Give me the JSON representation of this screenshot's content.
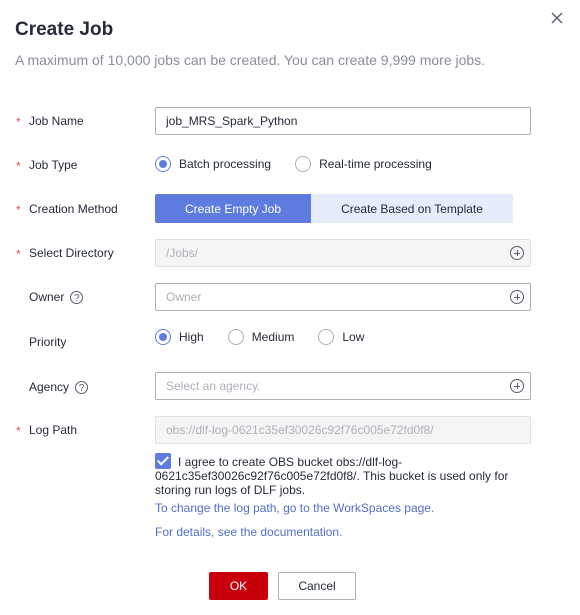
{
  "dialog": {
    "title": "Create Job",
    "subtitle": "A maximum of 10,000 jobs can be created. You can create 9,999 more jobs."
  },
  "form": {
    "job_name": {
      "label": "Job Name",
      "value": "job_MRS_Spark_Python"
    },
    "job_type": {
      "label": "Job Type",
      "options": [
        "Batch processing",
        "Real-time processing"
      ],
      "selected": "Batch processing"
    },
    "creation_method": {
      "label": "Creation Method",
      "options": [
        "Create Empty Job",
        "Create Based on Template"
      ],
      "selected": "Create Empty Job"
    },
    "select_directory": {
      "label": "Select Directory",
      "value": "/Jobs/"
    },
    "owner": {
      "label": "Owner",
      "placeholder": "Owner"
    },
    "priority": {
      "label": "Priority",
      "options": [
        "High",
        "Medium",
        "Low"
      ],
      "selected": "High"
    },
    "agency": {
      "label": "Agency",
      "placeholder": "Select an agency."
    },
    "log_path": {
      "label": "Log Path",
      "value": "obs://dlf-log-0621c35ef30026c92f76c005e72fd0f8/"
    },
    "required_mark": "*",
    "help_glyph": "?"
  },
  "agreement": {
    "checked": true,
    "text": "I agree to create OBS bucket obs://dlf-log-0621c35ef30026c92f76c005e72fd0f8/. This bucket is used only for storing run logs of DLF jobs."
  },
  "links": {
    "change_log_path": "To change the log path, go to the WorkSpaces page.",
    "details": "For details, see the documentation."
  },
  "footer": {
    "ok_label": "OK",
    "cancel_label": "Cancel"
  },
  "colors": {
    "primary": "#5e7ce0",
    "ok": "#c7000b",
    "required": "#de504e",
    "link": "#526ecc"
  }
}
